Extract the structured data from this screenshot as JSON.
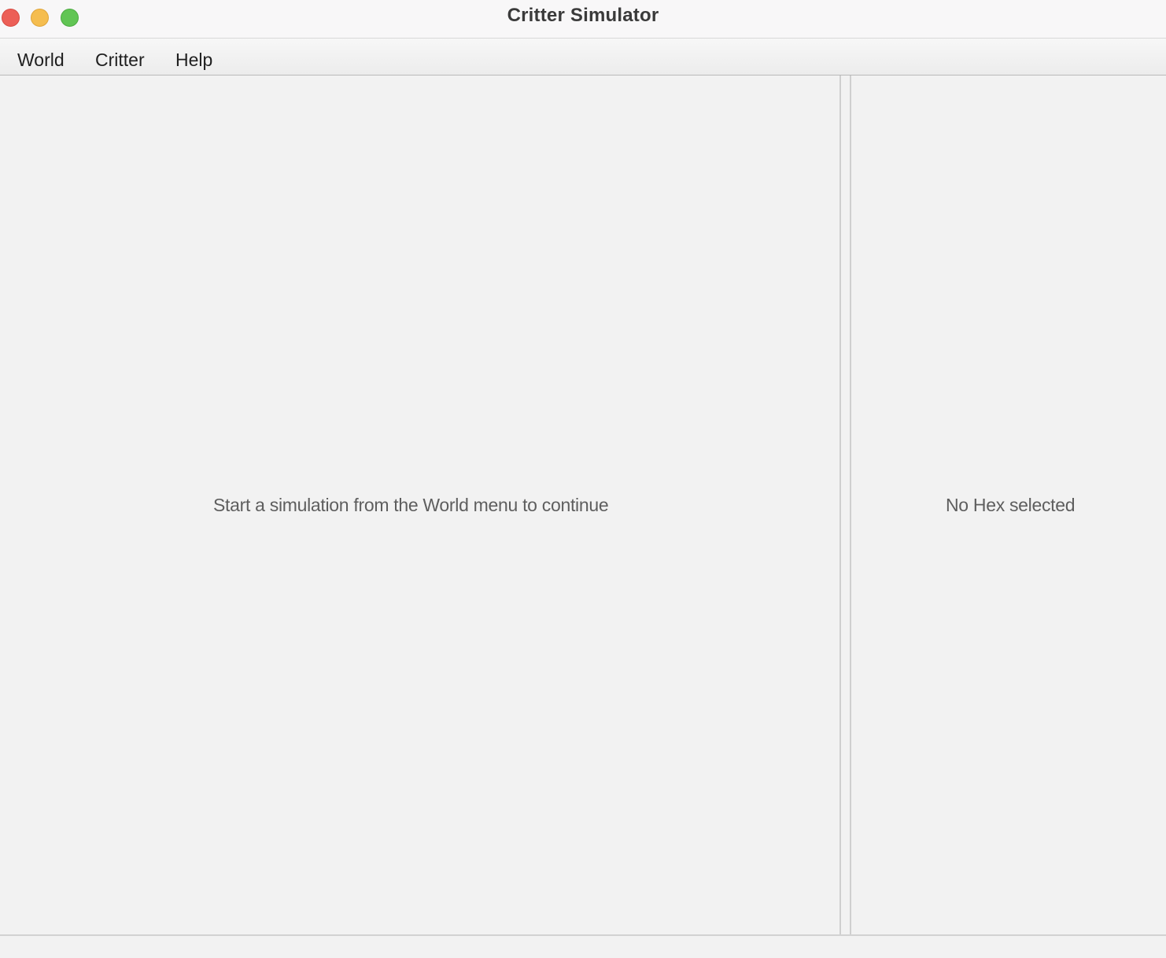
{
  "window": {
    "title": "Critter Simulator"
  },
  "titlebar": {
    "buttons": [
      {
        "name": "close",
        "color": "#ec5f57"
      },
      {
        "name": "minimize",
        "color": "#f5bd4f"
      },
      {
        "name": "zoom",
        "color": "#61c554"
      }
    ]
  },
  "menubar": {
    "items": [
      {
        "label": "World"
      },
      {
        "label": "Critter"
      },
      {
        "label": "Help"
      }
    ]
  },
  "world_pane": {
    "message": "Start a simulation from the World menu to continue"
  },
  "hex_pane": {
    "message": "No Hex selected"
  }
}
